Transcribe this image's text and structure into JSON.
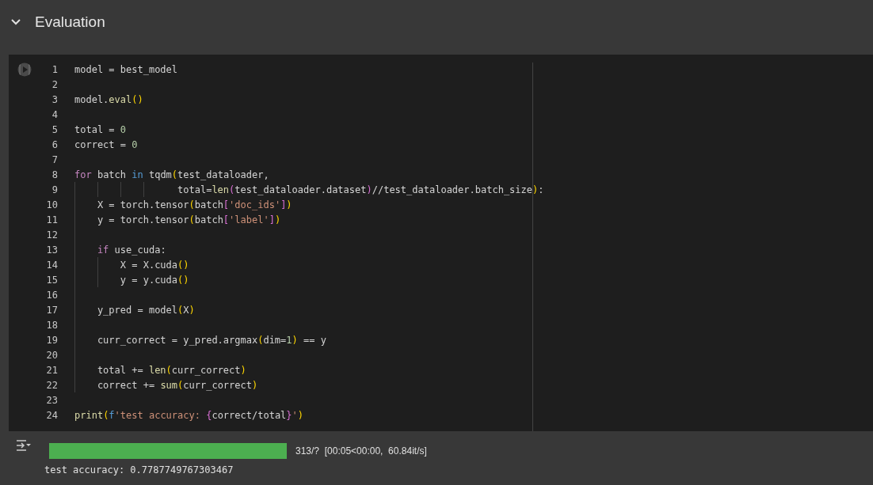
{
  "section": {
    "title": "Evaluation",
    "expanded": true
  },
  "code_lines": [
    {
      "number": "1",
      "tokens": [
        {
          "text": "model = best_model",
          "kind": "plain"
        }
      ]
    },
    {
      "number": "2"
    },
    {
      "number": "3",
      "tokens": [
        {
          "text": "model.",
          "kind": "plain"
        },
        {
          "text": "eval",
          "kind": "fn"
        },
        {
          "text": "()",
          "kind": "paren"
        }
      ]
    },
    {
      "number": "4"
    },
    {
      "number": "5",
      "tokens": [
        {
          "text": "total = ",
          "kind": "plain"
        },
        {
          "text": "0",
          "kind": "num"
        }
      ]
    },
    {
      "number": "6",
      "tokens": [
        {
          "text": "correct = ",
          "kind": "plain"
        },
        {
          "text": "0",
          "kind": "num"
        }
      ]
    },
    {
      "number": "7"
    },
    {
      "number": "8",
      "tokens": [
        {
          "text": "for",
          "kind": "kw"
        },
        {
          "text": " batch ",
          "kind": "plain"
        },
        {
          "text": "in",
          "kind": "blue"
        },
        {
          "text": " tqdm",
          "kind": "plain"
        },
        {
          "text": "(",
          "kind": "paren"
        },
        {
          "text": "test_dataloader,",
          "kind": "plain"
        }
      ]
    },
    {
      "number": "9",
      "tokens": [
        {
          "text": "                  total=",
          "kind": "plain"
        },
        {
          "text": "len",
          "kind": "fn"
        },
        {
          "text": "(",
          "kind": "bracket"
        },
        {
          "text": "test_dataloader.dataset",
          "kind": "plain"
        },
        {
          "text": ")",
          "kind": "bracket"
        },
        {
          "text": "//test_dataloader.batch_size",
          "kind": "plain"
        },
        {
          "text": ")",
          "kind": "paren"
        },
        {
          "text": ":",
          "kind": "plain"
        }
      ]
    },
    {
      "number": "10",
      "tokens": [
        {
          "text": "    X = torch.tensor",
          "kind": "plain"
        },
        {
          "text": "(",
          "kind": "paren"
        },
        {
          "text": "batch",
          "kind": "plain"
        },
        {
          "text": "[",
          "kind": "bracket"
        },
        {
          "text": "'doc_ids'",
          "kind": "str"
        },
        {
          "text": "]",
          "kind": "bracket"
        },
        {
          "text": ")",
          "kind": "paren"
        }
      ]
    },
    {
      "number": "11",
      "tokens": [
        {
          "text": "    y = torch.tensor",
          "kind": "plain"
        },
        {
          "text": "(",
          "kind": "paren"
        },
        {
          "text": "batch",
          "kind": "plain"
        },
        {
          "text": "[",
          "kind": "bracket"
        },
        {
          "text": "'label'",
          "kind": "str"
        },
        {
          "text": "]",
          "kind": "bracket"
        },
        {
          "text": ")",
          "kind": "paren"
        }
      ]
    },
    {
      "number": "12"
    },
    {
      "number": "13",
      "tokens": [
        {
          "text": "    if",
          "kind": "kw"
        },
        {
          "text": " use_cuda:",
          "kind": "plain"
        }
      ]
    },
    {
      "number": "14",
      "tokens": [
        {
          "text": "        X = X.cuda",
          "kind": "plain"
        },
        {
          "text": "()",
          "kind": "paren"
        }
      ]
    },
    {
      "number": "15",
      "tokens": [
        {
          "text": "        y = y.cuda",
          "kind": "plain"
        },
        {
          "text": "()",
          "kind": "paren"
        }
      ]
    },
    {
      "number": "16"
    },
    {
      "number": "17",
      "tokens": [
        {
          "text": "    y_pred = model",
          "kind": "plain"
        },
        {
          "text": "(",
          "kind": "paren"
        },
        {
          "text": "X",
          "kind": "plain"
        },
        {
          "text": ")",
          "kind": "paren"
        }
      ]
    },
    {
      "number": "18"
    },
    {
      "number": "19",
      "tokens": [
        {
          "text": "    curr_correct = y_pred.argmax",
          "kind": "plain"
        },
        {
          "text": "(",
          "kind": "paren"
        },
        {
          "text": "dim=",
          "kind": "plain"
        },
        {
          "text": "1",
          "kind": "num"
        },
        {
          "text": ")",
          "kind": "paren"
        },
        {
          "text": " == y",
          "kind": "plain"
        }
      ]
    },
    {
      "number": "20"
    },
    {
      "number": "21",
      "tokens": [
        {
          "text": "    total += ",
          "kind": "plain"
        },
        {
          "text": "len",
          "kind": "fn"
        },
        {
          "text": "(",
          "kind": "paren"
        },
        {
          "text": "curr_correct",
          "kind": "plain"
        },
        {
          "text": ")",
          "kind": "paren"
        }
      ]
    },
    {
      "number": "22",
      "tokens": [
        {
          "text": "    correct += ",
          "kind": "plain"
        },
        {
          "text": "sum",
          "kind": "fn"
        },
        {
          "text": "(",
          "kind": "paren"
        },
        {
          "text": "curr_correct",
          "kind": "plain"
        },
        {
          "text": ")",
          "kind": "paren"
        }
      ]
    },
    {
      "number": "23"
    },
    {
      "number": "24",
      "tokens": [
        {
          "text": "print",
          "kind": "fn"
        },
        {
          "text": "(",
          "kind": "paren"
        },
        {
          "text": "f",
          "kind": "blue"
        },
        {
          "text": "'test accuracy: ",
          "kind": "str"
        },
        {
          "text": "{",
          "kind": "bracket"
        },
        {
          "text": "correct/total",
          "kind": "plain"
        },
        {
          "text": "}",
          "kind": "bracket"
        },
        {
          "text": "'",
          "kind": "str"
        },
        {
          "text": ")",
          "kind": "paren"
        }
      ]
    }
  ],
  "output": {
    "progress": {
      "level": 1.0,
      "reading": "313/?  [00:05<00:00,  60.84it/s]"
    },
    "text": "test accuracy: 0.7787749767303467"
  }
}
